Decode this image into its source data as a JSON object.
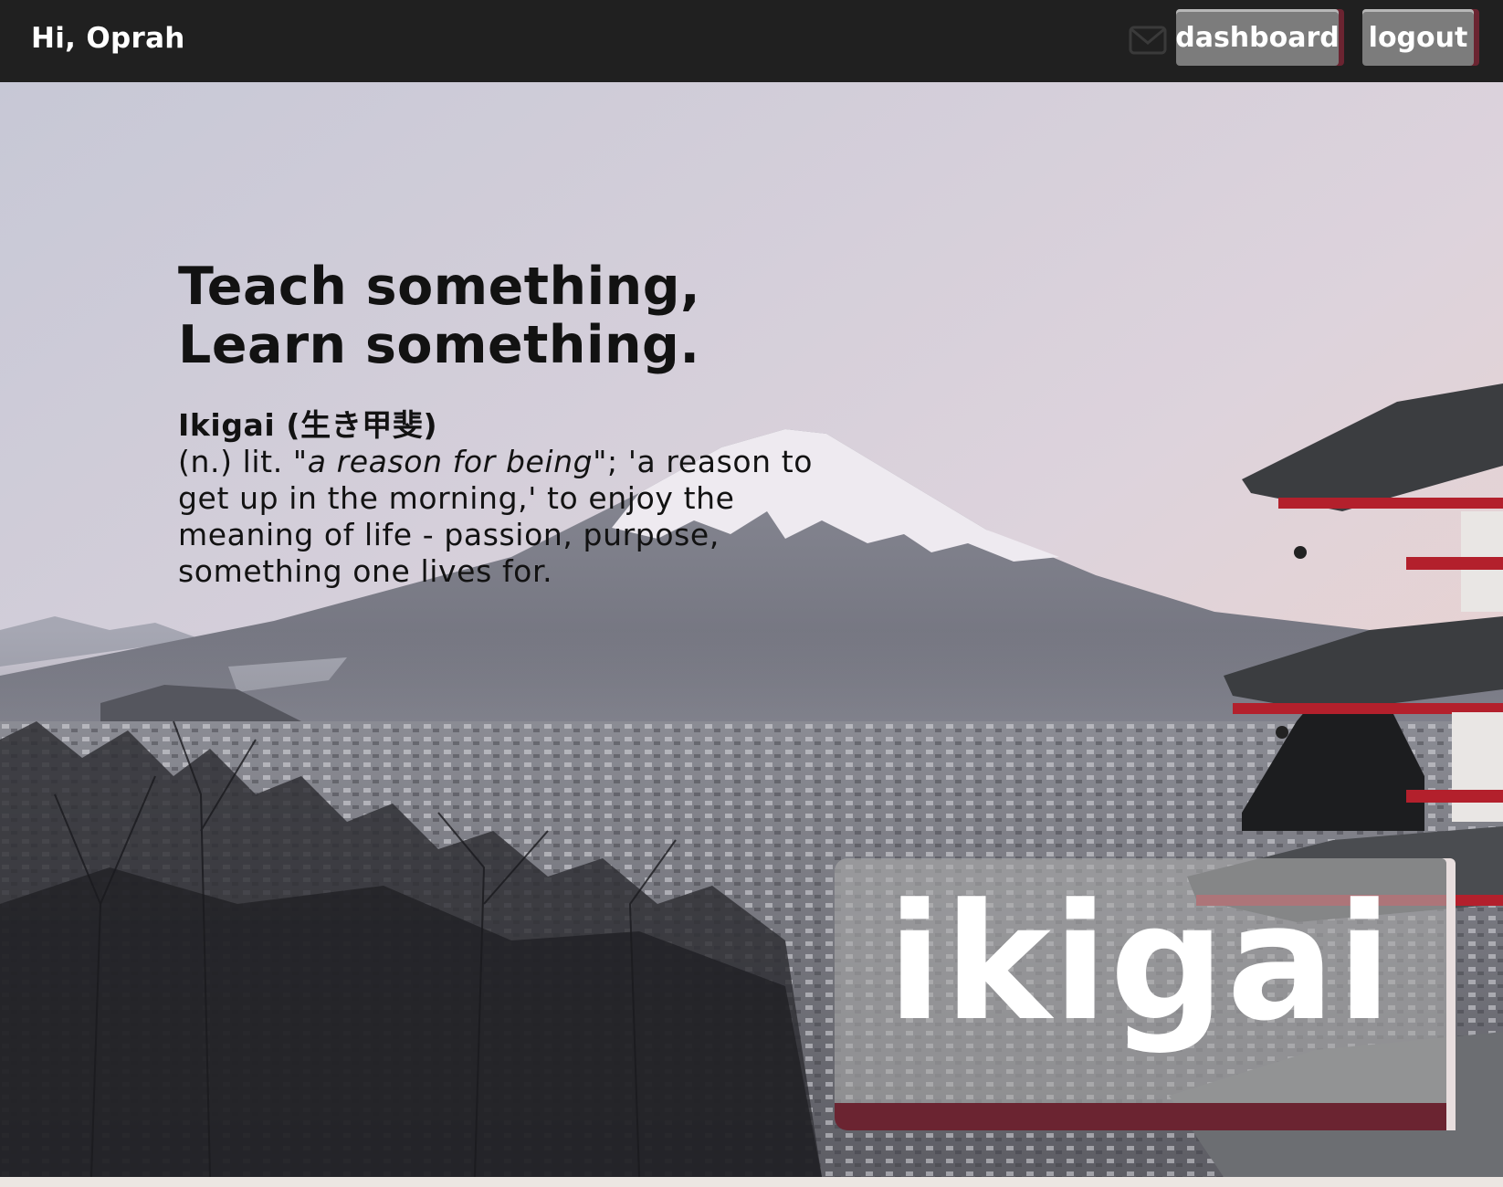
{
  "header": {
    "greeting": "Hi, Oprah",
    "mail_icon": "envelope-icon",
    "dashboard_label": "dashboard",
    "logout_label": "logout"
  },
  "hero": {
    "tagline_line1": "Teach something,",
    "tagline_line2": "Learn something.",
    "definition_term": "Ikigai (生き甲斐)",
    "definition_prefix": "(n.) lit. \"",
    "definition_italic": "a reason for being",
    "definition_suffix": "\"; 'a reason to get up in the morning,' to enjoy the meaning of life - passion, purpose, something one lives for.",
    "background": "mount-fuji-pagoda-photo"
  },
  "logo": {
    "text": "ikigai"
  },
  "colors": {
    "topbar": "#202020",
    "button": "#7c7c7c",
    "accent": "#6b2431",
    "text_dark": "#121212"
  }
}
